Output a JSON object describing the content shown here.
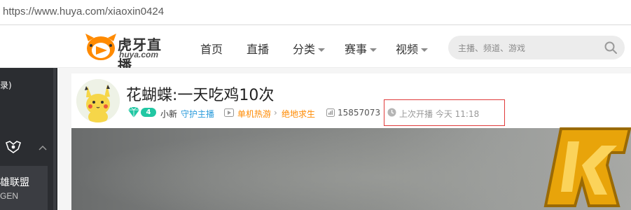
{
  "browser": {
    "url": "https://www.huya.com/xiaoxin0424"
  },
  "header": {
    "logo_title": "虎牙直播",
    "logo_sub": "huya.com",
    "nav": [
      {
        "label": "首页"
      },
      {
        "label": "直播"
      },
      {
        "label": "分类"
      },
      {
        "label": "赛事"
      },
      {
        "label": "视频"
      }
    ],
    "search_placeholder": "主播、频道、游戏"
  },
  "sidebar": {
    "partial_text": "录)",
    "game_name": "英雄联盟",
    "game_name_visible": "雄联盟",
    "game_sub": "GEN"
  },
  "room": {
    "title": "花蝴蝶:一天吃鸡10次",
    "level": "4",
    "anchor_name": "小新",
    "guard_label": "守护主播",
    "category": "单机热游",
    "subcategory": "绝地求生",
    "viewers": "15857073",
    "last_live": "上次开播 今天 11:18"
  },
  "colors": {
    "accent_orange": "#ff8a00",
    "guard_blue": "#2d9cdb",
    "level_teal": "#21c7a3",
    "highlight_red": "#e03a3a",
    "sidebar_dark": "#2b2d31"
  }
}
